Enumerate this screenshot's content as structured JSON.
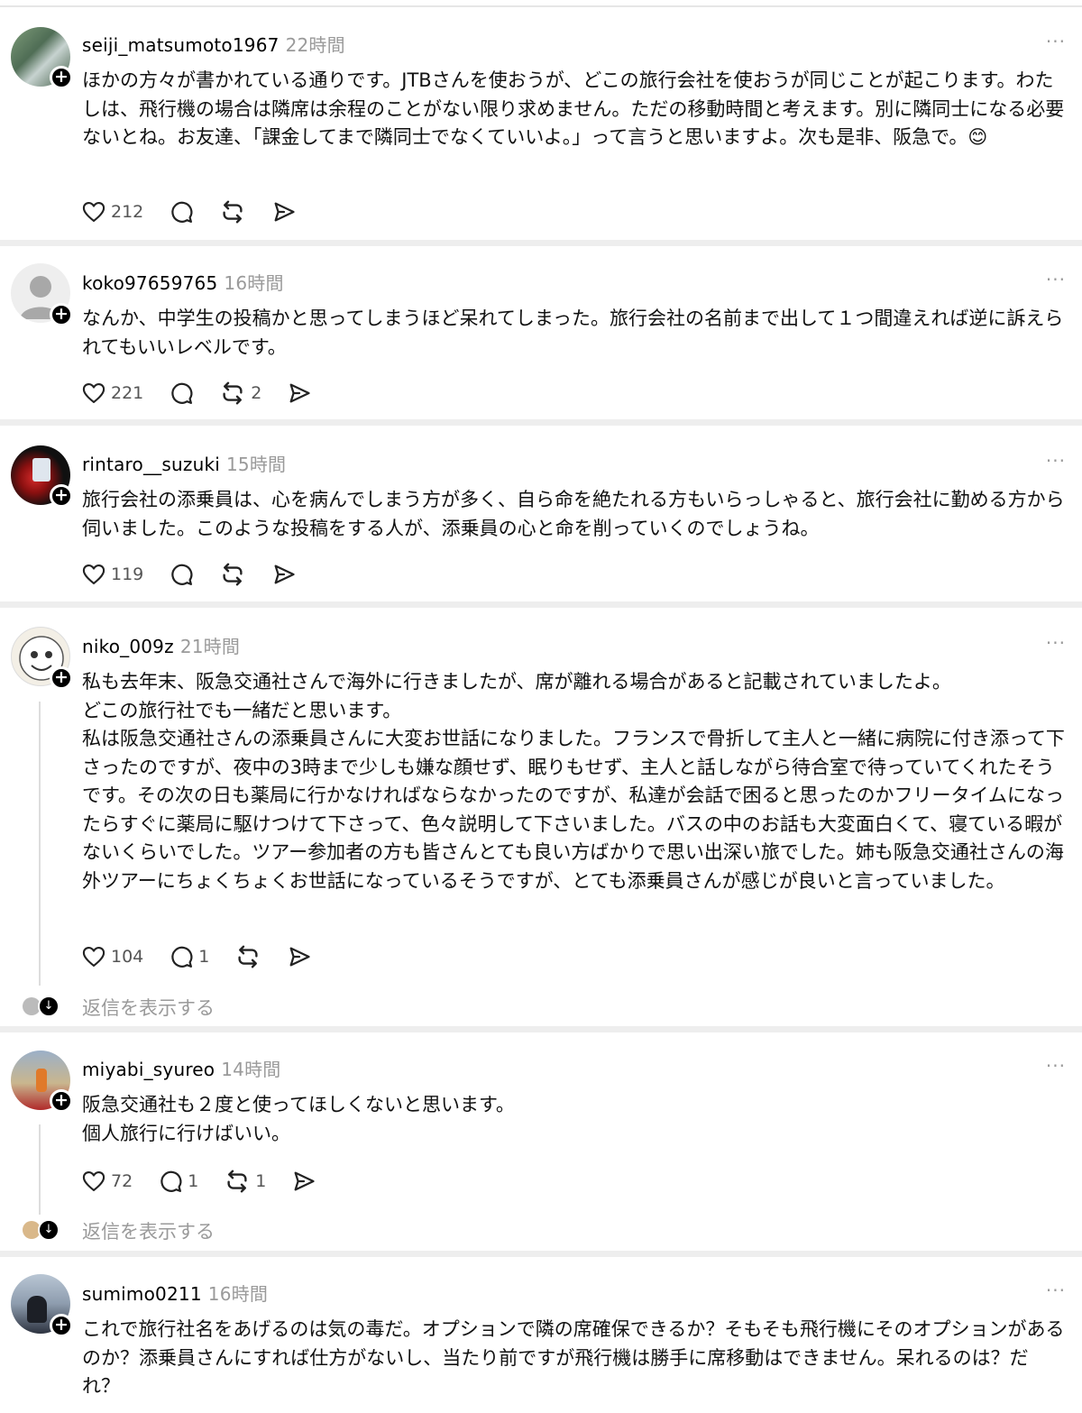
{
  "posts": [
    {
      "username": "seiji_matsumoto1967",
      "time": "22時間",
      "more": "···",
      "text": "ほかの方々が書かれている通りです。JTBさんを使おうが、どこの旅行会社を使おうが同じことが起こります。わたしは、飛行機の場合は隣席は余程のことがない限り求めません。ただの移動時間と考えます。別に隣同士になる必要ないとね。お友達、「課金してまで隣同士でなくていいよ。」って言うと思いますよ。次も是非、阪急で。😊",
      "likes": "212",
      "replies": "",
      "reposts": ""
    },
    {
      "username": "koko97659765",
      "time": "16時間",
      "more": "···",
      "text": "なんか、中学生の投稿かと思ってしまうほど呆れてしまった。旅行会社の名前まで出して１つ間違えれば逆に訴えられてもいいレベルです。",
      "likes": "221",
      "replies": "",
      "reposts": "2"
    },
    {
      "username": "rintaro__suzuki",
      "time": "15時間",
      "more": "···",
      "text": "旅行会社の添乗員は、心を病んでしまう方が多く、自ら命を絶たれる方もいらっしゃると、旅行会社に勤める方から伺いました。このような投稿をする人が、添乗員の心と命を削っていくのでしょうね。",
      "likes": "119",
      "replies": "",
      "reposts": ""
    },
    {
      "username": "niko_009z",
      "time": "21時間",
      "more": "···",
      "text": "私も去年末、阪急交通社さんで海外に行きましたが、席が離れる場合があると記載されていましたよ。\nどこの旅行社でも一緒だと思います。\n私は阪急交通社さんの添乗員さんに大変お世話になりました。フランスで骨折して主人と一緒に病院に付き添って下さったのですが、夜中の3時まで少しも嫌な顔せず、眠りもせず、主人と話しながら待合室で待っていてくれたそうです。その次の日も薬局に行かなければならなかったのですが、私達が会話で困ると思ったのかフリータイムになったらすぐに薬局に駆けつけて下さって、色々説明して下さいました。バスの中のお話も大変面白くて、寝ている暇がないくらいでした。ツアー参加者の方も皆さんとても良い方ばかりで思い出深い旅でした。姉も阪急交通社さんの海外ツアーにちょくちょくお世話になっているそうですが、とても添乗員さんが感じが良いと言っていました。",
      "likes": "104",
      "replies": "1",
      "reposts": "",
      "show_replies": "返信を表示する"
    },
    {
      "username": "miyabi_syureo",
      "time": "14時間",
      "more": "···",
      "text": "阪急交通社も２度と使ってほしくないと思います。\n個人旅行に行けばいい。",
      "likes": "72",
      "replies": "1",
      "reposts": "1",
      "show_replies": "返信を表示する"
    },
    {
      "username": "sumimo0211",
      "time": "16時間",
      "more": "···",
      "text": "これで旅行社名をあげるのは気の毒だ。オプションで隣の席確保できるか？そもそも飛行機にそのオプションがあるのか？添乗員さんにすれば仕方がないし、当たり前ですが飛行機は勝手に席移動はできません。呆れるのは？だれ？"
    }
  ],
  "icons": {
    "like": "heart-icon",
    "reply": "comment-bubble-icon",
    "repost": "repost-arrows-icon",
    "share": "send-arrow-icon",
    "follow": "plus-icon"
  },
  "colors": {
    "text": "#111111",
    "muted": "#9a9a9a",
    "separator": "#eeeeee"
  }
}
